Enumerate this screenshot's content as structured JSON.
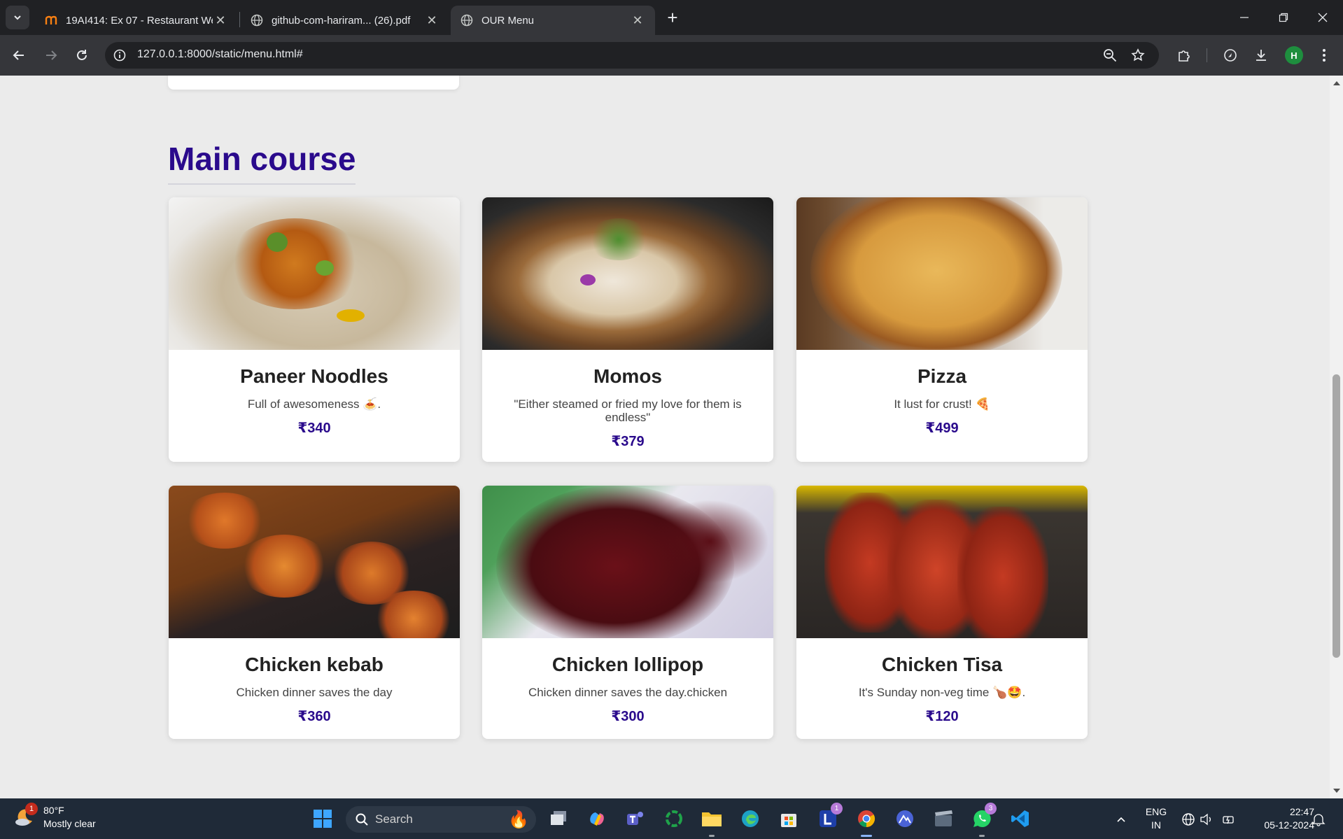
{
  "browser": {
    "tabs": [
      {
        "title": "19AI414: Ex 07 - Restaurant We",
        "favicon": "moodle-icon",
        "active": false
      },
      {
        "title": "github-com-hariram... (26).pdf",
        "favicon": "globe-icon",
        "active": false
      },
      {
        "title": "OUR Menu",
        "favicon": "globe-icon",
        "active": true
      }
    ],
    "url": "127.0.0.1:8000/static/menu.html#",
    "profile_initial": "H"
  },
  "page": {
    "section_title": "Main course",
    "items": [
      {
        "name": "Paneer Noodles",
        "description": "Full of awesomeness 🍝.",
        "price": "₹340",
        "image": "paneer-noodles-photo"
      },
      {
        "name": "Momos",
        "description": "\"Either steamed or fried my love for them is endless\"",
        "price": "₹379",
        "image": "momos-photo"
      },
      {
        "name": "Pizza",
        "description": "It lust for crust! 🍕",
        "price": "₹499",
        "image": "pizza-photo"
      },
      {
        "name": "Chicken kebab",
        "description": "Chicken dinner saves the day",
        "price": "₹360",
        "image": "chicken-kebab-photo"
      },
      {
        "name": "Chicken lollipop",
        "description": "Chicken dinner saves the day.chicken",
        "price": "₹300",
        "image": "chicken-lollipop-photo"
      },
      {
        "name": "Chicken Tisa",
        "description": "It's Sunday non-veg time 🍗🤩.",
        "price": "₹120",
        "image": "chicken-tisa-photo"
      }
    ],
    "accent_color": "#2a0a8c"
  },
  "taskbar": {
    "weather": {
      "temp": "80°F",
      "condition": "Mostly clear",
      "badge": "1"
    },
    "search_placeholder": "Search",
    "lang_line1": "ENG",
    "lang_line2": "IN",
    "time": "22:47",
    "date": "05-12-2024",
    "badges": {
      "lens": "1",
      "whatsapp": "3"
    }
  }
}
